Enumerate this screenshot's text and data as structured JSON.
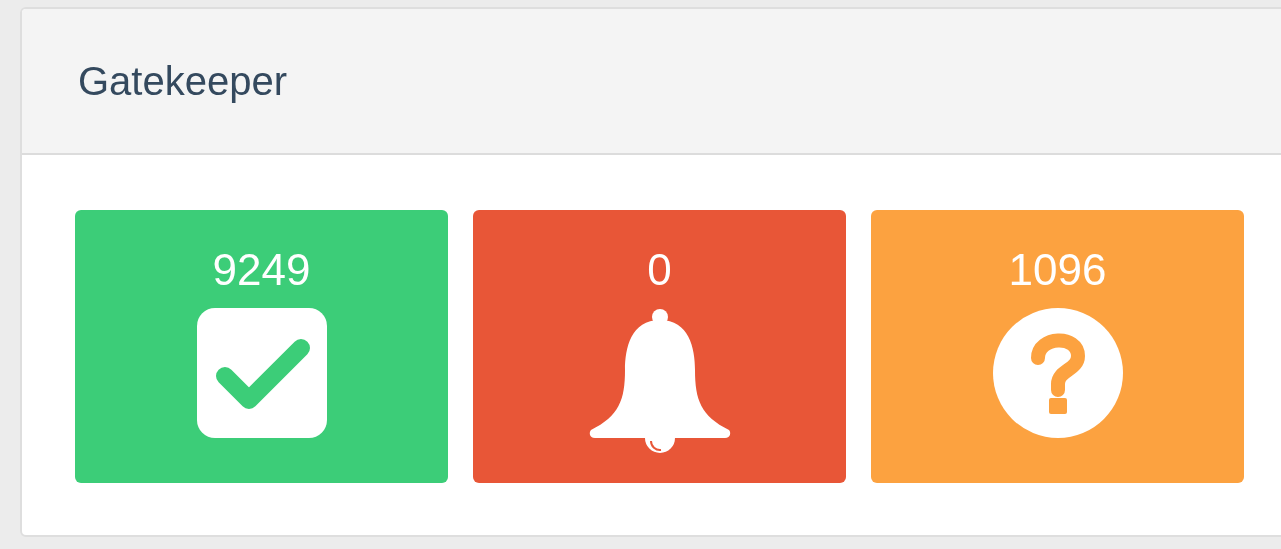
{
  "panel": {
    "title": "Gatekeeper"
  },
  "tiles": [
    {
      "kind": "check",
      "count": "9249",
      "color": "#3ccd78"
    },
    {
      "kind": "bell",
      "count": "0",
      "color": "#e85637"
    },
    {
      "kind": "question",
      "count": "1096",
      "color": "#fca240"
    }
  ]
}
